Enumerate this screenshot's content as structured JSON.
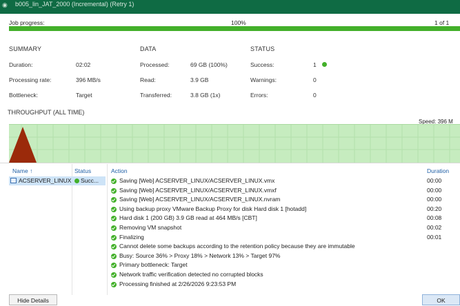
{
  "window": {
    "title": "b005_lin_JAT_2000 (Incremental) (Retry 1)"
  },
  "progress": {
    "label": "Job progress:",
    "percent_text": "100%",
    "count": "1 of 1",
    "value": 100
  },
  "summary": {
    "heading": "SUMMARY",
    "items": [
      {
        "label": "Duration:",
        "value": "02:02"
      },
      {
        "label": "Processing rate:",
        "value": "396 MB/s"
      },
      {
        "label": "Bottleneck:",
        "value": "Target"
      }
    ]
  },
  "data": {
    "heading": "DATA",
    "items": [
      {
        "label": "Processed:",
        "value": "69 GB (100%)"
      },
      {
        "label": "Read:",
        "value": "3.9 GB"
      },
      {
        "label": "Transferred:",
        "value": "3.8 GB (1x)"
      }
    ]
  },
  "status": {
    "heading": "STATUS",
    "items": [
      {
        "label": "Success:",
        "value": "1"
      },
      {
        "label": "Warnings:",
        "value": "0"
      },
      {
        "label": "Errors:",
        "value": "0"
      }
    ],
    "success_color": "#43b02a"
  },
  "throughput": {
    "heading": "THROUGHPUT (ALL TIME)",
    "speed": "Speed: 396 M"
  },
  "columns": {
    "name": "Name",
    "status": "Status",
    "action": "Action",
    "duration": "Duration"
  },
  "vms": [
    {
      "name": "ACSERVER_LINUX",
      "status": "Succ..."
    }
  ],
  "actions": [
    {
      "text": "Saving [Web] ACSERVER_LINUX/ACSERVER_LINUX.vmx",
      "duration": "00:00"
    },
    {
      "text": "Saving [Web] ACSERVER_LINUX/ACSERVER_LINUX.vmxf",
      "duration": "00:00"
    },
    {
      "text": "Saving [Web] ACSERVER_LINUX/ACSERVER_LINUX.nvram",
      "duration": "00:00"
    },
    {
      "text": "Using backup proxy VMware Backup Proxy for disk Hard disk 1 [hotadd]",
      "duration": "00:20"
    },
    {
      "text": "Hard disk 1 (200 GB) 3.9 GB read at 464 MB/s [CBT]",
      "duration": "00:08"
    },
    {
      "text": "Removing VM snapshot",
      "duration": "00:02"
    },
    {
      "text": "Finalizing",
      "duration": "00:01"
    },
    {
      "text": "Cannot delete some backups according to the retention policy because they are immutable",
      "duration": ""
    },
    {
      "text": "Busy: Source 36% > Proxy 18% > Network 13% > Target 97%",
      "duration": ""
    },
    {
      "text": "Primary bottleneck: Target",
      "duration": ""
    },
    {
      "text": "Network traffic verification detected no corrupted blocks",
      "duration": ""
    },
    {
      "text": "Processing finished at 2/26/2026 9:23:53 PM",
      "duration": ""
    }
  ],
  "buttons": {
    "hide_details": "Hide Details",
    "ok": "OK"
  },
  "colors": {
    "title_bar": "#0f6b44",
    "progress": "#43b02a",
    "graph_fill": "#c6ecbf",
    "graph_peak": "#9b2a0a",
    "link_blue": "#1f5fa6"
  }
}
